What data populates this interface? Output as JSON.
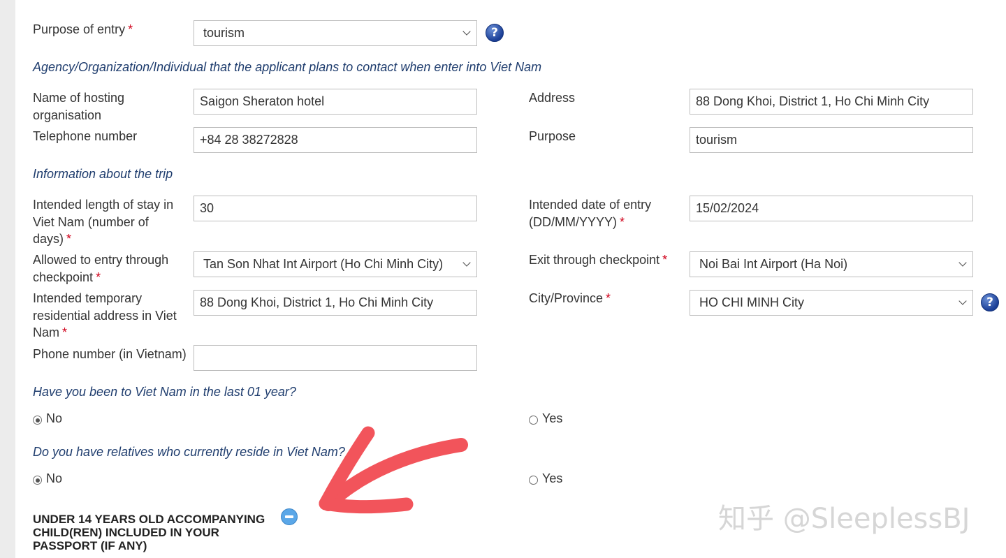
{
  "form": {
    "purpose_of_entry": {
      "label": "Purpose of entry",
      "value": "tourism"
    },
    "section_agency": "Agency/Organization/Individual that the applicant plans to contact when enter into Viet Nam",
    "hosting_org": {
      "label": "Name of hosting organisation",
      "value": "Saigon Sheraton hotel"
    },
    "address": {
      "label": "Address",
      "value": "88 Dong Khoi, District 1, Ho Chi Minh City"
    },
    "telephone": {
      "label": "Telephone number",
      "value": "+84 28 38272828"
    },
    "purpose": {
      "label": "Purpose",
      "value": "tourism"
    },
    "section_trip": "Information about the trip",
    "length_of_stay": {
      "label": "Intended length of stay in Viet Nam (number of days)",
      "value": "30"
    },
    "date_of_entry": {
      "label": "Intended date of entry (DD/MM/YYYY)",
      "value": "15/02/2024"
    },
    "entry_checkpoint": {
      "label": "Allowed to entry through checkpoint",
      "value": "Tan Son Nhat Int Airport (Ho Chi Minh City)"
    },
    "exit_checkpoint": {
      "label": "Exit through checkpoint",
      "value": "Noi Bai Int Airport (Ha Noi)"
    },
    "temp_address": {
      "label": "Intended temporary residential address in Viet Nam",
      "value": "88 Dong Khoi, District 1, Ho Chi Minh City"
    },
    "city_province": {
      "label": "City/Province",
      "value": "HO CHI MINH City"
    },
    "phone_vn": {
      "label": "Phone number (in Vietnam)",
      "value": ""
    },
    "q_visited": {
      "question": "Have you been to Viet Nam in the last 01 year?",
      "no": "No",
      "yes": "Yes",
      "selected": "No"
    },
    "q_relatives": {
      "question": "Do you have relatives who currently reside in Viet Nam?",
      "no": "No",
      "yes": "Yes",
      "selected": "No"
    },
    "children_heading": "UNDER 14 YEARS OLD ACCOMPANYING CHILD(REN) INCLUDED IN YOUR PASSPORT (IF ANY)"
  },
  "required_marker": "*",
  "help_glyph": "?",
  "icons": {
    "help": "question-circle-icon",
    "collapse": "minus-circle-icon",
    "dropdown": "chevron-down-icon"
  },
  "overlay": {
    "arrow_color": "#f2545b",
    "watermark": "知乎 @SleeplessBJ"
  },
  "colors": {
    "section_text": "#1f3d6e",
    "required": "#d0021b",
    "help_icon": "#1b3f97",
    "collapse_icon": "#5aa7e8"
  }
}
